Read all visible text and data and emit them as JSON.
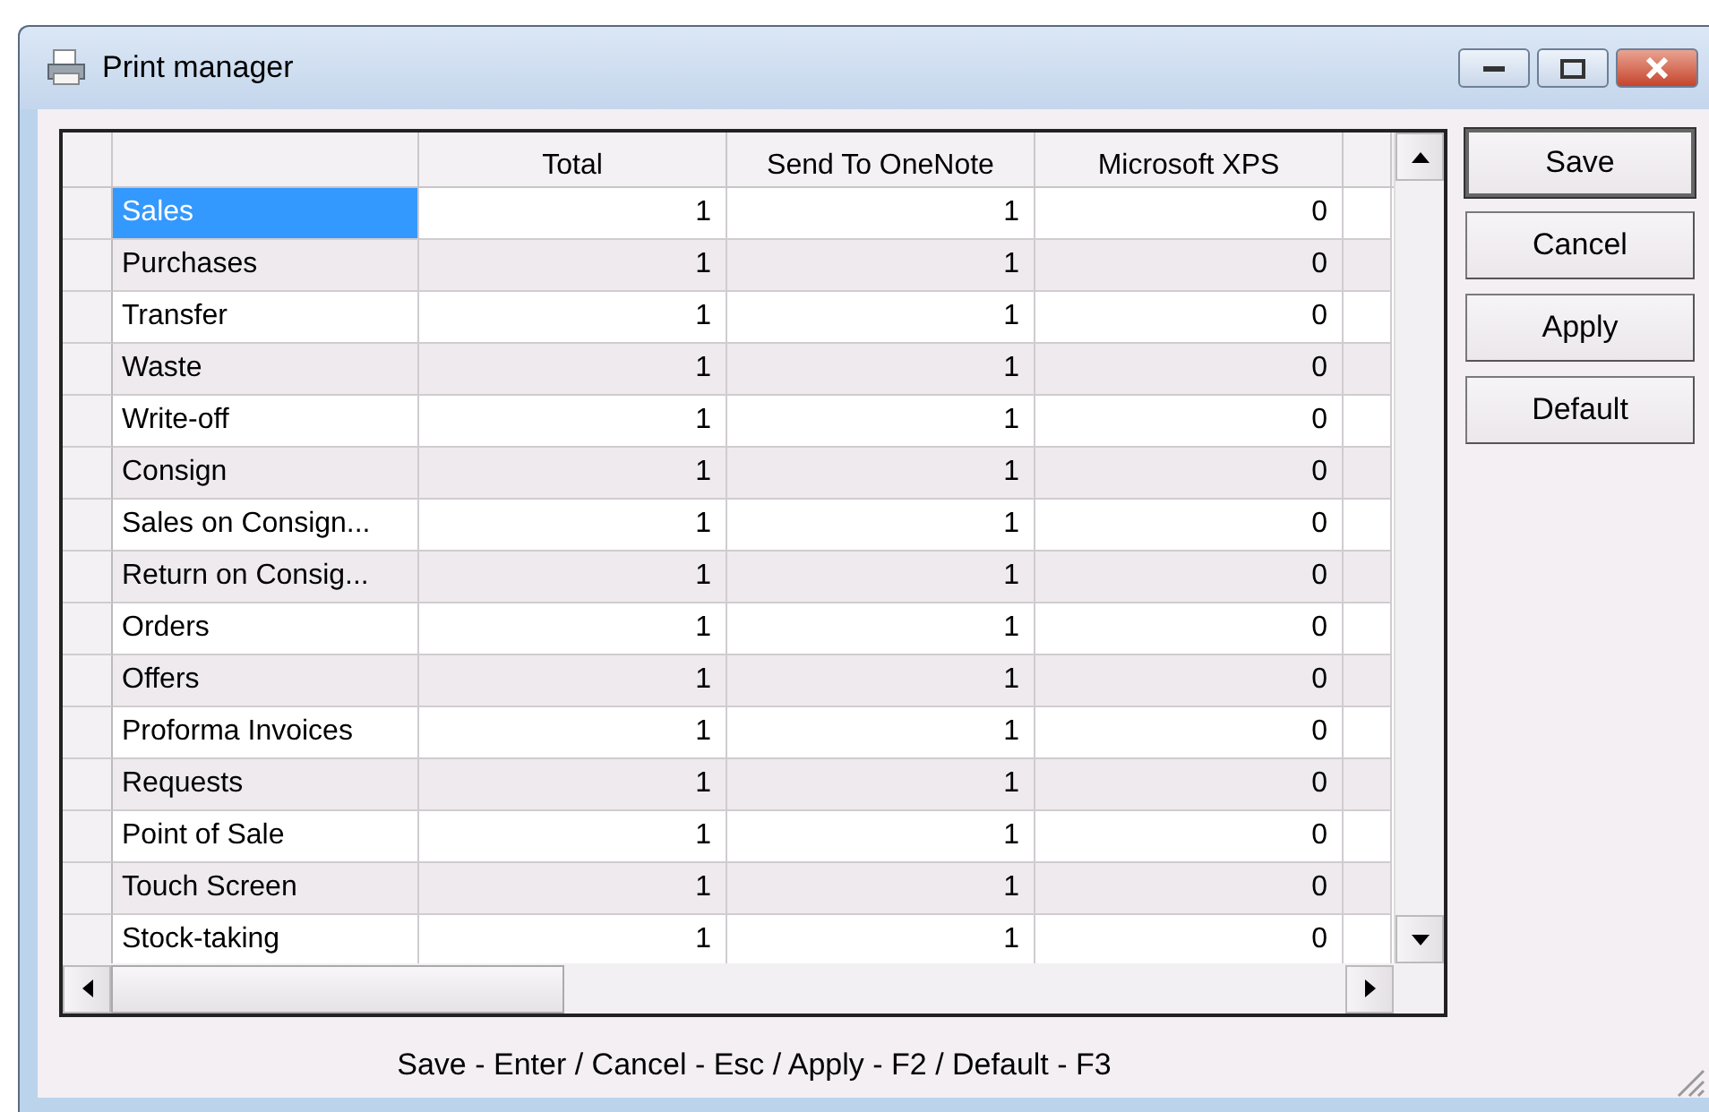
{
  "window": {
    "title": "Print manager"
  },
  "table": {
    "columns": [
      "",
      "Total",
      "Send To OneNote",
      "Microsoft XPS"
    ],
    "rows": [
      {
        "name": "Sales",
        "total": "1",
        "send_to_onenote": "1",
        "microsoft_xps": "0",
        "selected": true
      },
      {
        "name": "Purchases",
        "total": "1",
        "send_to_onenote": "1",
        "microsoft_xps": "0",
        "selected": false
      },
      {
        "name": "Transfer",
        "total": "1",
        "send_to_onenote": "1",
        "microsoft_xps": "0",
        "selected": false
      },
      {
        "name": "Waste",
        "total": "1",
        "send_to_onenote": "1",
        "microsoft_xps": "0",
        "selected": false
      },
      {
        "name": "Write-off",
        "total": "1",
        "send_to_onenote": "1",
        "microsoft_xps": "0",
        "selected": false
      },
      {
        "name": "Consign",
        "total": "1",
        "send_to_onenote": "1",
        "microsoft_xps": "0",
        "selected": false
      },
      {
        "name": "Sales on Consign...",
        "total": "1",
        "send_to_onenote": "1",
        "microsoft_xps": "0",
        "selected": false
      },
      {
        "name": "Return on Consig...",
        "total": "1",
        "send_to_onenote": "1",
        "microsoft_xps": "0",
        "selected": false
      },
      {
        "name": "Orders",
        "total": "1",
        "send_to_onenote": "1",
        "microsoft_xps": "0",
        "selected": false
      },
      {
        "name": "Offers",
        "total": "1",
        "send_to_onenote": "1",
        "microsoft_xps": "0",
        "selected": false
      },
      {
        "name": "Proforma Invoices",
        "total": "1",
        "send_to_onenote": "1",
        "microsoft_xps": "0",
        "selected": false
      },
      {
        "name": "Requests",
        "total": "1",
        "send_to_onenote": "1",
        "microsoft_xps": "0",
        "selected": false
      },
      {
        "name": "Point of Sale",
        "total": "1",
        "send_to_onenote": "1",
        "microsoft_xps": "0",
        "selected": false
      },
      {
        "name": "Touch Screen",
        "total": "1",
        "send_to_onenote": "1",
        "microsoft_xps": "0",
        "selected": false
      },
      {
        "name": "Stock-taking",
        "total": "1",
        "send_to_onenote": "1",
        "microsoft_xps": "0",
        "selected": false
      }
    ]
  },
  "buttons": [
    {
      "label": "Save",
      "default": true
    },
    {
      "label": "Cancel",
      "default": false
    },
    {
      "label": "Apply",
      "default": false
    },
    {
      "label": "Default",
      "default": false
    }
  ],
  "status_bar": "Save - Enter / Cancel - Esc / Apply - F2 / Default - F3"
}
